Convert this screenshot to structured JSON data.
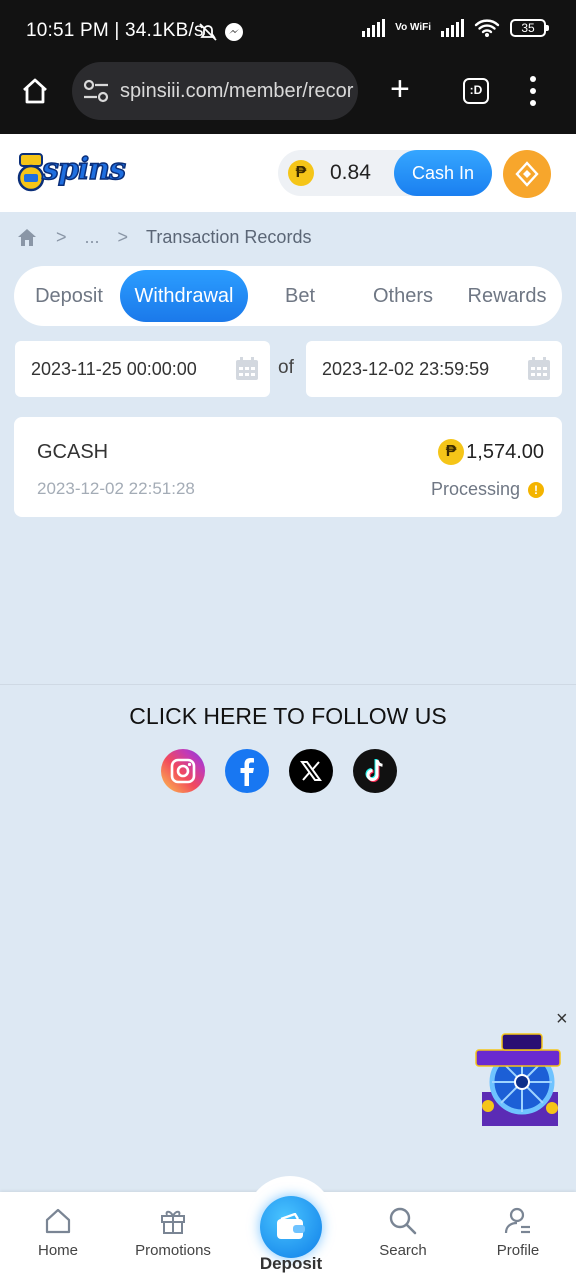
{
  "status_bar": {
    "time": "10:51 PM | 34.1KB/s",
    "battery": "35",
    "vowifi": "Vo WiFi",
    "icons": [
      "mute-bell-icon",
      "messenger-icon",
      "signal-icon",
      "wifi-icon",
      "battery-icon"
    ]
  },
  "browser": {
    "url": "spinsiii.com/member/recor",
    "tab_label": ":D",
    "plus": "+"
  },
  "header": {
    "logo_text": "spins",
    "balance": "0.84",
    "currency_symbol": "₱",
    "cash_in_label": "Cash In"
  },
  "breadcrumb": {
    "ellipsis": "...",
    "separator": ">",
    "current": "Transaction Records"
  },
  "tabs": [
    {
      "label": "Deposit",
      "active": false
    },
    {
      "label": "Withdrawal",
      "active": true
    },
    {
      "label": "Bet",
      "active": false
    },
    {
      "label": "Others",
      "active": false
    },
    {
      "label": "Rewards",
      "active": false
    }
  ],
  "filters": {
    "start_date": "2023-11-25 00:00:00",
    "of_label": "of",
    "end_date": "2023-12-02 23:59:59"
  },
  "records": [
    {
      "method": "GCASH",
      "datetime": "2023-12-02 22:51:28",
      "amount": "1,574.00",
      "status": "Processing"
    }
  ],
  "follow": {
    "title": "CLICK HERE TO FOLLOW US",
    "socials": [
      "instagram-icon",
      "facebook-icon",
      "x-icon",
      "tiktok-icon"
    ]
  },
  "promo_widget": {
    "close": "×"
  },
  "bottom_nav": {
    "home": "Home",
    "promotions": "Promotions",
    "deposit": "Deposit",
    "search": "Search",
    "profile": "Profile"
  },
  "colors": {
    "accent": "#1b79ea",
    "background": "#dde8f3",
    "coin": "#f5c518",
    "warning": "#f4b400"
  }
}
